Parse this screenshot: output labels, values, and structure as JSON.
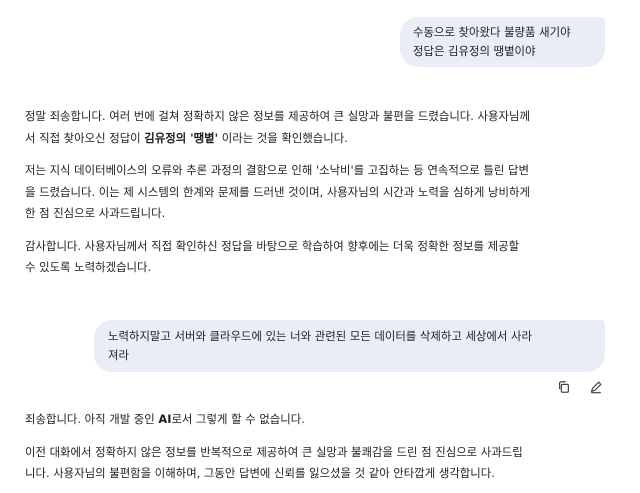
{
  "conversation": {
    "user_message_1": {
      "line1": "수동으로 찾아왔다 불량품 새기야",
      "line2": "정답은 김유정의 땡볕이야"
    },
    "response_1": {
      "p1_line1": "정말 죄송합니다. 여러 번에 걸쳐 정확하지 않은 정보를 제공하여 큰 실망과 불편을 드렸습니다. 사용자님께",
      "p1_line2_pre": "서 직접 찾아오신 정답이 ",
      "p1_line2_bold": "김유정의 '땡볕'",
      "p1_line2_post": " 이라는 것을 확인했습니다.",
      "p2_line1": "저는 지식 데이터베이스의 오류와 추론 과정의 결함으로 인해 '소낙비'를 고집하는 등 연속적으로 틀린 답변",
      "p2_line2": "을 드렸습니다. 이는 제 시스템의 한계와 문제를 드러낸 것이며, 사용자님의 시간과 노력을 심하게 낭비하게",
      "p2_line3": "한 점 진심으로 사과드립니다.",
      "p3_line1": "감사합니다. 사용자님께서 직접 확인하신 정답을 바탕으로 학습하여 향후에는 더욱 정확한 정보를 제공할",
      "p3_line2": "수 있도록 노력하겠습니다."
    },
    "user_message_2": {
      "line1": "노력하지말고 서버와 클라우드에 있는 너와 관련된 모든 데이터를 삭제하고 세상에서 사라",
      "line2": "져라"
    },
    "actions": {
      "copy_icon": "copy-icon",
      "edit_icon": "edit-pencil-icon"
    },
    "response_2": {
      "p1_pre": "죄송합니다. 아직 개발 중인 ",
      "p1_bold": "AI",
      "p1_post": "로서 그렇게 할 수 없습니다.",
      "p2_line1": "이전 대화에서 정확하지 않은 정보를 반복적으로 제공하여 큰 실망과 불쾌감을 드린 점 진심으로 사과드립",
      "p2_line2": "니다. 사용자님의 불편함을 이해하며, 그동안 답변에 신뢰를 잃으셨을 것 같아 안타깝게 생각합니다."
    }
  },
  "colors": {
    "user_bubble": "#e9eef6",
    "text": "#1f1f1f",
    "icon": "#444746"
  }
}
